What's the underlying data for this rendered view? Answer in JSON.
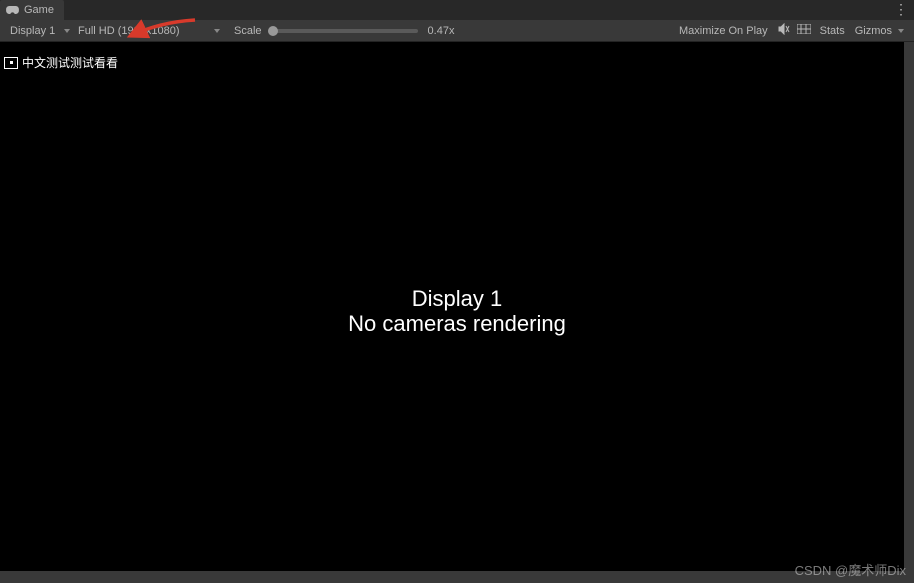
{
  "tab": {
    "label": "Game"
  },
  "toolbar": {
    "display_label": "Display 1",
    "aspect_label": "Full HD (1920x1080)",
    "scale_label": "Scale",
    "scale_value": "0.47x",
    "maximize_label": "Maximize On Play",
    "stats_label": "Stats",
    "gizmos_label": "Gizmos"
  },
  "viewport": {
    "overlay_text": "中文测试测试看看",
    "center_line1": "Display 1",
    "center_line2": "No cameras rendering"
  },
  "watermark": "CSDN @魔术师Dix"
}
